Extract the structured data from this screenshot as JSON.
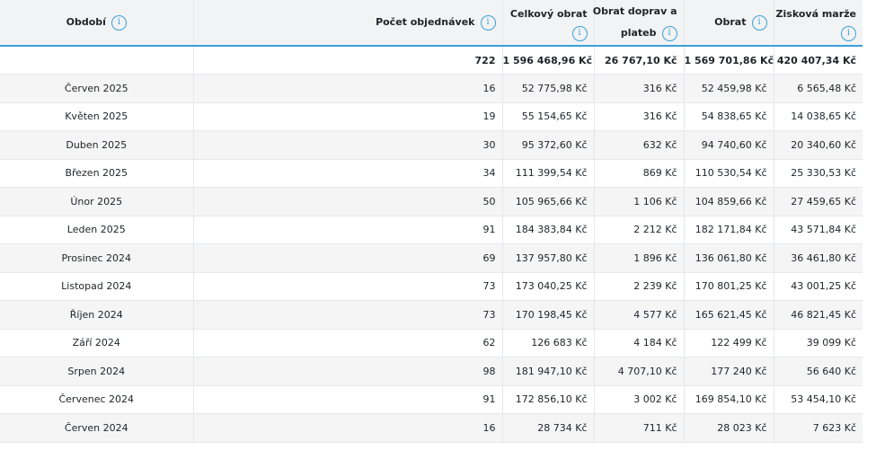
{
  "header": {
    "period": "Období",
    "orders": "Počet objednávek",
    "total_revenue": "Celkový obrat",
    "shipping_line1": "Obrat doprav a",
    "shipping_line2": "plateb",
    "revenue": "Obrat",
    "margin": "Zisková marže"
  },
  "totals": {
    "period": "",
    "orders": "722",
    "total_revenue": "1 596 468,96 Kč",
    "shipping": "26 767,10 Kč",
    "revenue": "1 569 701,86 Kč",
    "margin": "420 407,34 Kč"
  },
  "rows": [
    {
      "period": "Červen 2025",
      "orders": "16",
      "total_revenue": "52 775,98 Kč",
      "shipping": "316 Kč",
      "revenue": "52 459,98 Kč",
      "margin": "6 565,48 Kč"
    },
    {
      "period": "Květen 2025",
      "orders": "19",
      "total_revenue": "55 154,65 Kč",
      "shipping": "316 Kč",
      "revenue": "54 838,65 Kč",
      "margin": "14 038,65 Kč"
    },
    {
      "period": "Duben 2025",
      "orders": "30",
      "total_revenue": "95 372,60 Kč",
      "shipping": "632 Kč",
      "revenue": "94 740,60 Kč",
      "margin": "20 340,60 Kč"
    },
    {
      "period": "Březen 2025",
      "orders": "34",
      "total_revenue": "111 399,54 Kč",
      "shipping": "869 Kč",
      "revenue": "110 530,54 Kč",
      "margin": "25 330,53 Kč"
    },
    {
      "period": "Únor 2025",
      "orders": "50",
      "total_revenue": "105 965,66 Kč",
      "shipping": "1 106 Kč",
      "revenue": "104 859,66 Kč",
      "margin": "27 459,65 Kč"
    },
    {
      "period": "Leden 2025",
      "orders": "91",
      "total_revenue": "184 383,84 Kč",
      "shipping": "2 212 Kč",
      "revenue": "182 171,84 Kč",
      "margin": "43 571,84 Kč"
    },
    {
      "period": "Prosinec 2024",
      "orders": "69",
      "total_revenue": "137 957,80 Kč",
      "shipping": "1 896 Kč",
      "revenue": "136 061,80 Kč",
      "margin": "36 461,80 Kč"
    },
    {
      "period": "Listopad 2024",
      "orders": "73",
      "total_revenue": "173 040,25 Kč",
      "shipping": "2 239 Kč",
      "revenue": "170 801,25 Kč",
      "margin": "43 001,25 Kč"
    },
    {
      "period": "Říjen 2024",
      "orders": "73",
      "total_revenue": "170 198,45 Kč",
      "shipping": "4 577 Kč",
      "revenue": "165 621,45 Kč",
      "margin": "46 821,45 Kč"
    },
    {
      "period": "Září 2024",
      "orders": "62",
      "total_revenue": "126 683 Kč",
      "shipping": "4 184 Kč",
      "revenue": "122 499 Kč",
      "margin": "39 099 Kč"
    },
    {
      "period": "Srpen 2024",
      "orders": "98",
      "total_revenue": "181 947,10 Kč",
      "shipping": "4 707,10 Kč",
      "revenue": "177 240 Kč",
      "margin": "56 640 Kč"
    },
    {
      "period": "Červenec 2024",
      "orders": "91",
      "total_revenue": "172 856,10 Kč",
      "shipping": "3 002 Kč",
      "revenue": "169 854,10 Kč",
      "margin": "53 454,10 Kč"
    },
    {
      "period": "Červen 2024",
      "orders": "16",
      "total_revenue": "28 734 Kč",
      "shipping": "711 Kč",
      "revenue": "28 023 Kč",
      "margin": "7 623 Kč"
    }
  ]
}
